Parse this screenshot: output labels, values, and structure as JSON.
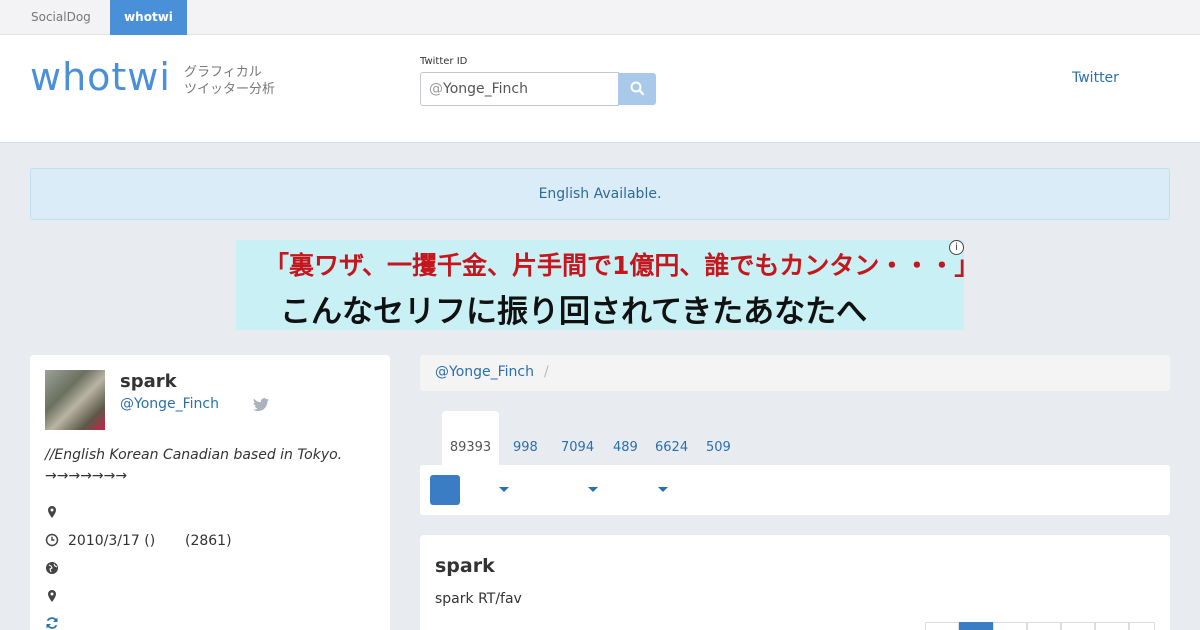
{
  "top_tabs": [
    {
      "label": "SocialDog"
    },
    {
      "label": "whotwi"
    }
  ],
  "header": {
    "logo": "whotwi",
    "tagline_line1": "グラフィカル",
    "tagline_line2": "ツイッター分析",
    "search_label": "Twitter ID",
    "search_at": "@",
    "search_value": "Yonge_Finch",
    "twitter_link": "Twitter"
  },
  "alert": "English Available.",
  "banner": {
    "line1": "「裏ワザ、一攫千金、片手間で1億円、誰でもカンタン・・・」",
    "line2": "こんなセリフに振り回されてきたあなたへ",
    "info": "i"
  },
  "profile": {
    "name": "spark",
    "handle": "@Yonge_Finch",
    "bio": "//English Korean Canadian based in Tokyo. →→→→→→→",
    "joined": "2010/3/17 ()",
    "days": "(2861)"
  },
  "breadcrumb": {
    "link": "@Yonge_Finch",
    "sep": "/"
  },
  "stats": [
    "89393",
    "998",
    "7094",
    "489",
    "6624",
    "509"
  ],
  "card": {
    "title": "spark",
    "subtitle": "spark RT/fav"
  },
  "colors": {
    "accent": "#4a90d9",
    "link": "#2a6fb0",
    "alert_bg": "#d9ecf7"
  }
}
